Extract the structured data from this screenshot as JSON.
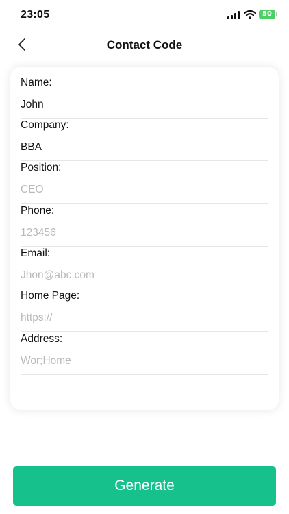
{
  "status_bar": {
    "time": "23:05",
    "battery": "50",
    "icons": [
      "cellular-signal-icon",
      "wifi-icon",
      "battery-icon"
    ],
    "battery_color": "#4bd066"
  },
  "nav": {
    "title": "Contact Code",
    "back_icon": "chevron-left-icon"
  },
  "form": {
    "fields": [
      {
        "label": "Name:",
        "value": "John",
        "placeholder": ""
      },
      {
        "label": "Company:",
        "value": "BBA",
        "placeholder": ""
      },
      {
        "label": "Position:",
        "value": "",
        "placeholder": "CEO"
      },
      {
        "label": "Phone:",
        "value": "",
        "placeholder": "123456"
      },
      {
        "label": "Email:",
        "value": "",
        "placeholder": "Jhon@abc.com"
      },
      {
        "label": "Home Page:",
        "value": "",
        "placeholder": "https://"
      },
      {
        "label": "Address:",
        "value": "",
        "placeholder": "Wor;Home"
      }
    ]
  },
  "actions": {
    "generate_label": "Generate",
    "accent_color": "#17c18b"
  }
}
